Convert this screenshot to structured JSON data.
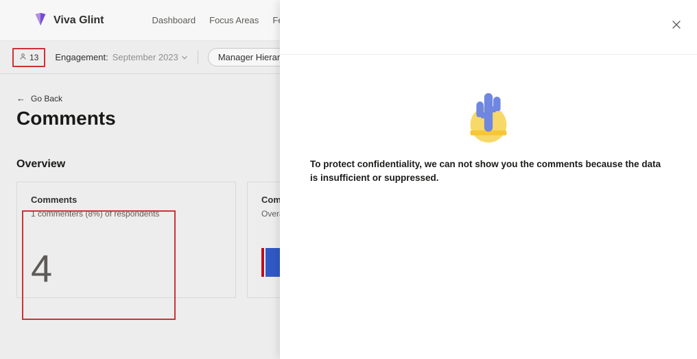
{
  "header": {
    "brand": "Viva Glint",
    "nav": [
      "Dashboard",
      "Focus Areas",
      "Feed"
    ]
  },
  "filters": {
    "people_count": "13",
    "engagement_label": "Engagement:",
    "engagement_value": "September 2023",
    "manager_label": "Manager Hierarchy:"
  },
  "page": {
    "back_label": "Go Back",
    "title": "Comments",
    "overview_label": "Overview"
  },
  "card_comments": {
    "title": "Comments",
    "subtitle": "1 commenters (8%) of respondents",
    "value": "4"
  },
  "card_sentiment": {
    "title": "Comm",
    "subtitle": "Overal"
  },
  "panel": {
    "message": "To protect confidentiality, we can not show you the comments because the data is insufficient or suppressed."
  }
}
